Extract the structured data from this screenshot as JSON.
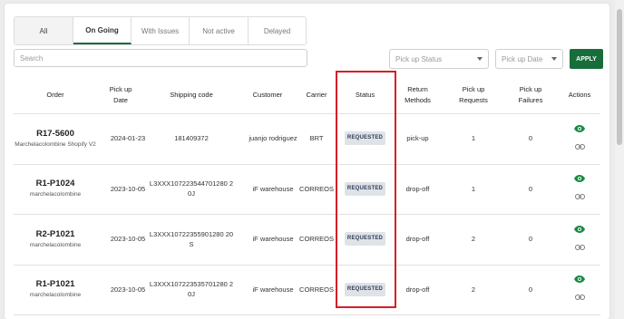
{
  "tabs": [
    {
      "label": "All"
    },
    {
      "label": "On Going"
    },
    {
      "label": "With Issues"
    },
    {
      "label": "Not active"
    },
    {
      "label": "Delayed"
    }
  ],
  "filters": {
    "search_placeholder": "Search",
    "pickup_status_placeholder": "Pick up Status",
    "pickup_date_placeholder": "Pick up Date",
    "apply_label": "APPLY"
  },
  "table": {
    "headers": {
      "order": "Order",
      "pickup_date": "Pick up\nDate",
      "shipping_code": "Shipping code",
      "customer": "Customer",
      "carrier": "Carrier",
      "status": "Status",
      "return_methods": "Return\nMethods",
      "pickup_requests": "Pick up\nRequests",
      "pickup_failures": "Pick up\nFailures",
      "actions": "Actions"
    },
    "rows": [
      {
        "order": "R17-5600",
        "store": "Marchelacolombine Shopify V2",
        "pickup_date": "2024-01-23",
        "shipping_code": "181409372",
        "customer": "juanjo rodriguez",
        "carrier": "BRT",
        "status": "REQUESTED",
        "return_method": "pick-up",
        "pickup_requests": "1",
        "pickup_failures": "0"
      },
      {
        "order": "R1-P1024",
        "store": "marchelacolombine",
        "pickup_date": "2023-10-05",
        "shipping_code": "L3XXX107223544701280 20J",
        "customer": "iF warehouse",
        "carrier": "CORREOS",
        "status": "REQUESTED",
        "return_method": "drop-off",
        "pickup_requests": "1",
        "pickup_failures": "0"
      },
      {
        "order": "R2-P1021",
        "store": "marchelacolombine",
        "pickup_date": "2023-10-05",
        "shipping_code": "L3XXX10722355901280 20S",
        "customer": "iF warehouse",
        "carrier": "CORREOS",
        "status": "REQUESTED",
        "return_method": "drop-off",
        "pickup_requests": "2",
        "pickup_failures": "0"
      },
      {
        "order": "R1-P1021",
        "store": "marchelacolombine",
        "pickup_date": "2023-10-05",
        "shipping_code": "L3XXX107223535701280 20J",
        "customer": "iF warehouse",
        "carrier": "CORREOS",
        "status": "REQUESTED",
        "return_method": "drop-off",
        "pickup_requests": "2",
        "pickup_failures": "0"
      }
    ]
  },
  "colors": {
    "accent": "#176e3b",
    "highlight": "#d32027",
    "badge_bg": "#dfe3e8"
  },
  "icons": {
    "view": "eye-icon",
    "link": "link-icon"
  }
}
